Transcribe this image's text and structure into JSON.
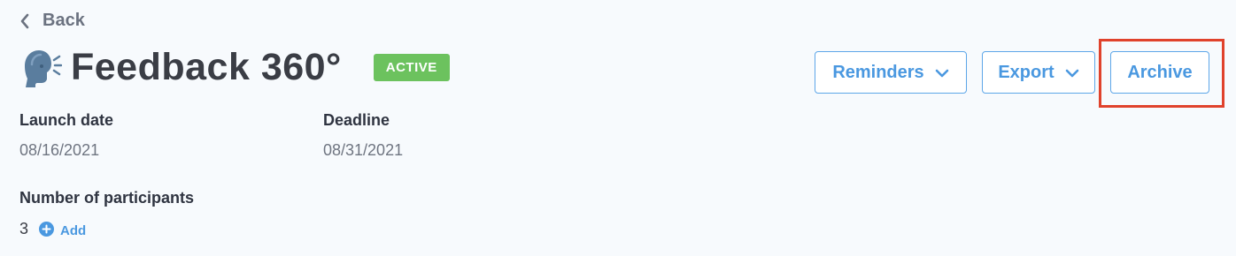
{
  "nav": {
    "back_label": "Back"
  },
  "header": {
    "title": "Feedback 360°",
    "status": "ACTIVE",
    "status_color": "#6cc25e"
  },
  "actions": {
    "reminders_label": "Reminders",
    "export_label": "Export",
    "archive_label": "Archive"
  },
  "details": {
    "launch_date_label": "Launch date",
    "launch_date_value": "08/16/2021",
    "deadline_label": "Deadline",
    "deadline_value": "08/31/2021",
    "participants_label": "Number of participants",
    "participants_count": "3",
    "add_label": "Add"
  },
  "colors": {
    "accent": "#4a98e0",
    "highlight": "#e0422c",
    "background": "#f7fafd"
  },
  "icons": [
    "chevron-left-icon",
    "speaking-head-icon",
    "chevron-down-icon",
    "plus-circle-icon"
  ]
}
